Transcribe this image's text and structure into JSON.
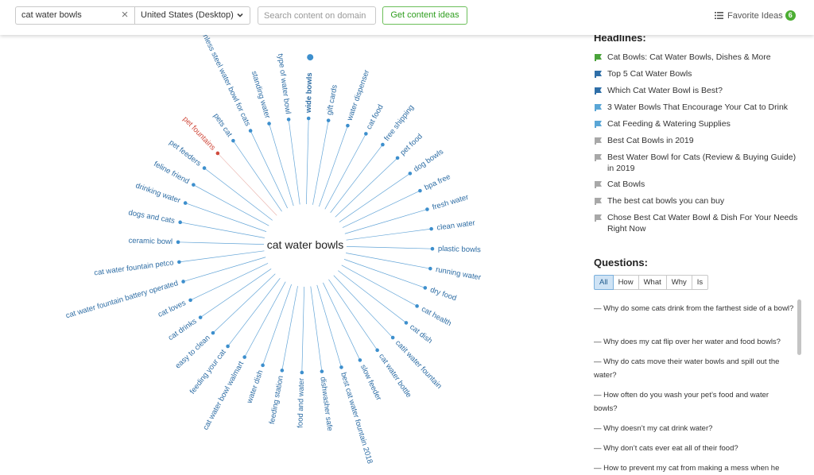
{
  "toolbar": {
    "keyword_value": "cat water bowls",
    "clear_glyph": "×",
    "country_value": "United States (Desktop)",
    "domain_placeholder": "Search content on domain",
    "ideas_button": "Get content ideas",
    "favorites_label": "Favorite Ideas",
    "favorites_count": "6"
  },
  "mindmap": {
    "center_label": "cat water bowls",
    "colors": {
      "spoke": "#3d8fcd",
      "label": "#2e6da4",
      "highlight": "#d04a3c"
    },
    "topics": [
      {
        "label": "stainless steel water bowl for cats"
      },
      {
        "label": "standing water"
      },
      {
        "label": "type of water bowl"
      },
      {
        "label": "wide bowls",
        "bold": true
      },
      {
        "label": "gift cards"
      },
      {
        "label": "water dispenser"
      },
      {
        "label": "cat food"
      },
      {
        "label": "free shipping"
      },
      {
        "label": "pet food"
      },
      {
        "label": "dog bowls"
      },
      {
        "label": "bpa free"
      },
      {
        "label": "fresh water"
      },
      {
        "label": "clean water"
      },
      {
        "label": "plastic bowls"
      },
      {
        "label": "running water"
      },
      {
        "label": "dry food"
      },
      {
        "label": "cat health"
      },
      {
        "label": "cat dish"
      },
      {
        "label": "catit water fountain"
      },
      {
        "label": "cat water bottle"
      },
      {
        "label": "slow feeder"
      },
      {
        "label": "best cat water fountain 2018"
      },
      {
        "label": "dishwasher safe"
      },
      {
        "label": "food and water"
      },
      {
        "label": "feeding station"
      },
      {
        "label": "water dish"
      },
      {
        "label": "cat water bowl walmart"
      },
      {
        "label": "feeding your cat"
      },
      {
        "label": "easy to clean"
      },
      {
        "label": "cat drinks"
      },
      {
        "label": "cat loves"
      },
      {
        "label": "cat water fountain battery operated"
      },
      {
        "label": "cat water fountain petco"
      },
      {
        "label": "ceramic bowl"
      },
      {
        "label": "dogs and cats"
      },
      {
        "label": "drinking water"
      },
      {
        "label": "feline friend"
      },
      {
        "label": "pet feeders"
      },
      {
        "label": "pet fountains",
        "highlight": true
      },
      {
        "label": "pets cat"
      }
    ]
  },
  "headlines": {
    "title": "Headlines:",
    "items": [
      {
        "text": "Cat Bowls: Cat Water Bowls, Dishes & More",
        "icon": "green-flag-icon",
        "color": "#4aa33a"
      },
      {
        "text": "Top 5 Cat Water Bowls",
        "icon": "blue-flag-icon",
        "color": "#2f6fa8"
      },
      {
        "text": "Which Cat Water Bowl is Best?",
        "icon": "blue-flag-icon",
        "color": "#2f6fa8"
      },
      {
        "text": "3 Water Bowls That Encourage Your Cat to Drink",
        "icon": "light-blue-flag-icon",
        "color": "#5aa6d6"
      },
      {
        "text": "Cat Feeding & Watering Supplies",
        "icon": "light-blue-flag-icon",
        "color": "#5aa6d6"
      },
      {
        "text": "Best Cat Bowls in 2019",
        "icon": "gray-flag-icon",
        "color": "#a8a8a8"
      },
      {
        "text": "Best Water Bowl for Cats (Review & Buying Guide) in 2019",
        "icon": "gray-flag-icon",
        "color": "#a8a8a8"
      },
      {
        "text": "Cat Bowls",
        "icon": "gray-flag-icon",
        "color": "#a8a8a8"
      },
      {
        "text": "The best cat bowls you can buy",
        "icon": "gray-flag-icon",
        "color": "#a8a8a8"
      },
      {
        "text": "Chose Best Cat Water Bowl & Dish For Your Needs Right Now",
        "icon": "gray-flag-icon",
        "color": "#a8a8a8"
      }
    ]
  },
  "questions": {
    "title": "Questions:",
    "tabs": [
      "All",
      "How",
      "What",
      "Why",
      "Is"
    ],
    "active_tab": "All",
    "items": [
      "— Why do some cats drink from the farthest side of a bowl?",
      "— Why does my cat flip over her water and food bowls?",
      "— Why do cats move their water bowls and spill out the water?",
      "— How often do you wash your pet’s food and water bowls?",
      "— Why doesn’t my cat drink water?",
      "— Why don’t cats ever eat all of their food?",
      "— How to prevent my cat from making a mess when he"
    ]
  }
}
